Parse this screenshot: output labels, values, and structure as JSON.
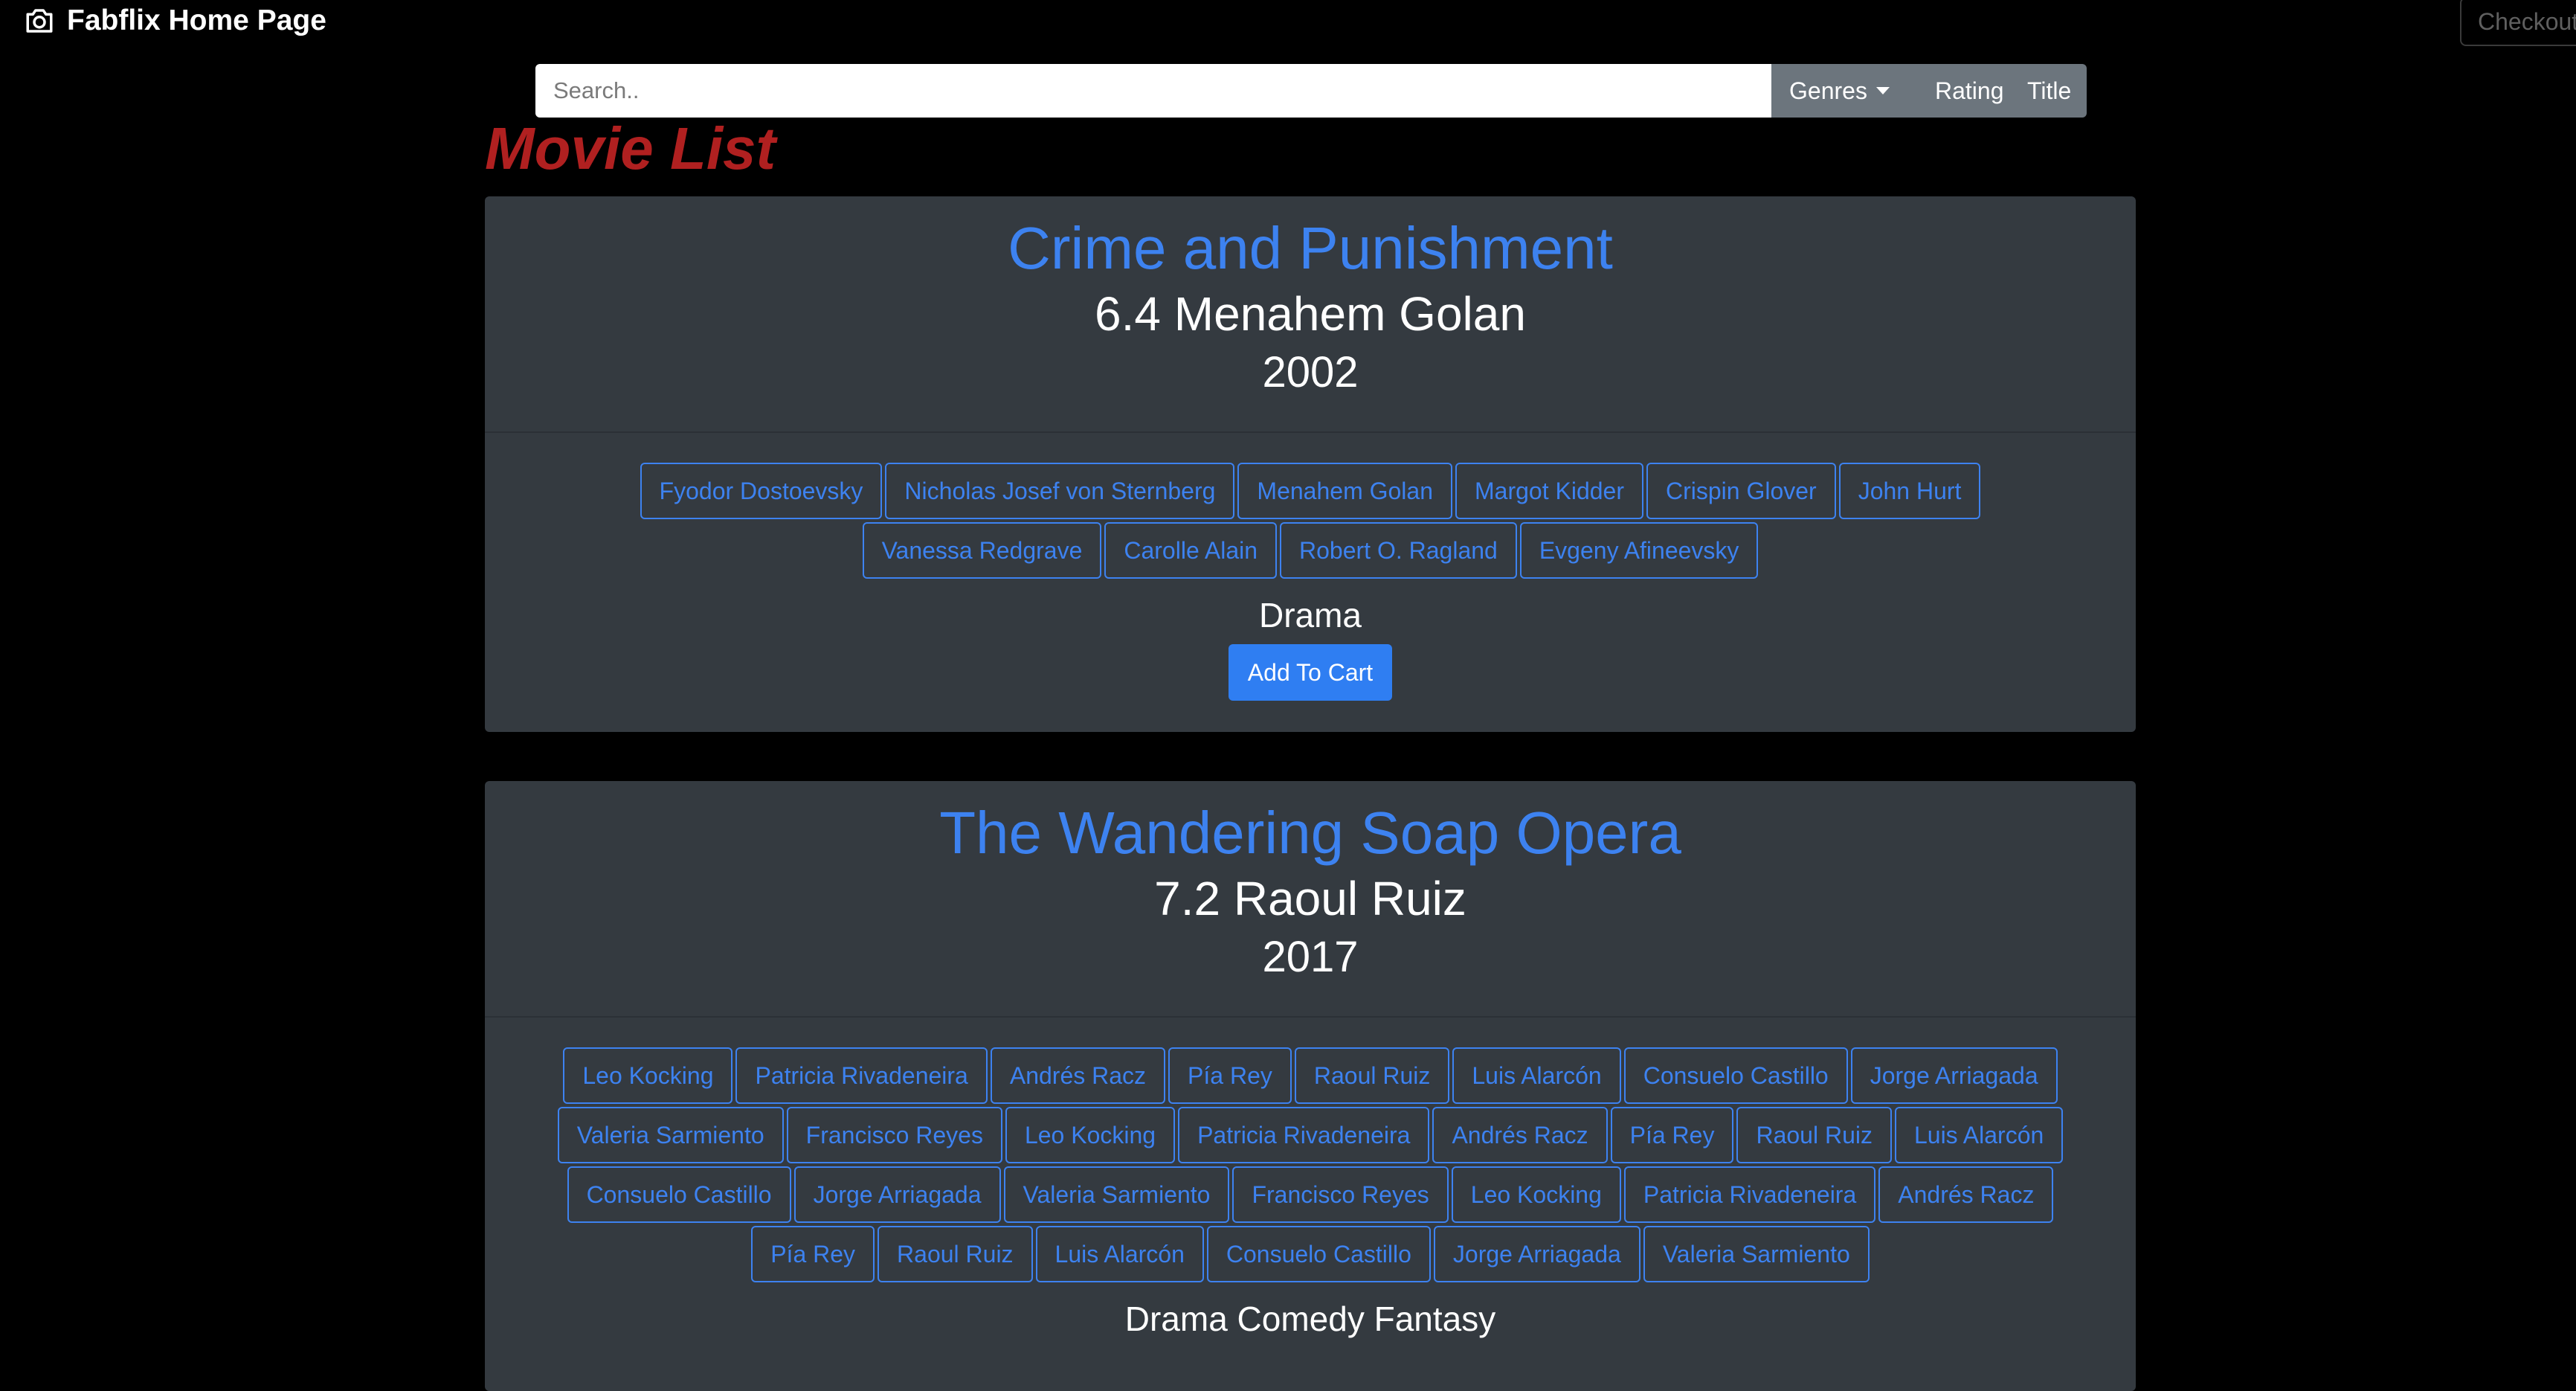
{
  "nav": {
    "brand": "Fabflix Home Page",
    "brand_icon": "camera-icon",
    "checkout_label": "Checkout"
  },
  "search": {
    "placeholder": "Search..",
    "filters": {
      "genres": "Genres",
      "rating": "Rating",
      "title": "Title"
    }
  },
  "page": {
    "heading": "Movie List"
  },
  "movies": [
    {
      "title": "Crime and Punishment",
      "subtitle": "6.4 Menahem Golan",
      "year": "2002",
      "stars": [
        "Fyodor Dostoevsky",
        "Nicholas Josef von Sternberg",
        "Menahem Golan",
        "Margot Kidder",
        "Crispin Glover",
        "John Hurt",
        "Vanessa Redgrave",
        "Carolle Alain",
        "Robert O. Ragland",
        "Evgeny Afineevsky"
      ],
      "genres": "Drama",
      "cart_label": "Add To Cart"
    },
    {
      "title": "The Wandering Soap Opera",
      "subtitle": "7.2 Raoul Ruiz",
      "year": "2017",
      "stars": [
        "Leo Kocking",
        "Patricia Rivadeneira",
        "Andrés Racz",
        "Pía Rey",
        "Raoul Ruiz",
        "Luis Alarcón",
        "Consuelo Castillo",
        "Jorge Arriagada",
        "Valeria Sarmiento",
        "Francisco Reyes",
        "Leo Kocking",
        "Patricia Rivadeneira",
        "Andrés Racz",
        "Pía Rey",
        "Raoul Ruiz",
        "Luis Alarcón",
        "Consuelo Castillo",
        "Jorge Arriagada",
        "Valeria Sarmiento",
        "Francisco Reyes",
        "Leo Kocking",
        "Patricia Rivadeneira",
        "Andrés Racz",
        "Pía Rey",
        "Raoul Ruiz",
        "Luis Alarcón",
        "Consuelo Castillo",
        "Jorge Arriagada",
        "Valeria Sarmiento"
      ],
      "genres": "Drama Comedy Fantasy"
    }
  ],
  "colors": {
    "background": "#000000",
    "card": "#343a40",
    "link": "#3d82f0",
    "heading": "#b02020",
    "filter_group": "#6c757d",
    "primary_button": "#2f7ef2"
  }
}
